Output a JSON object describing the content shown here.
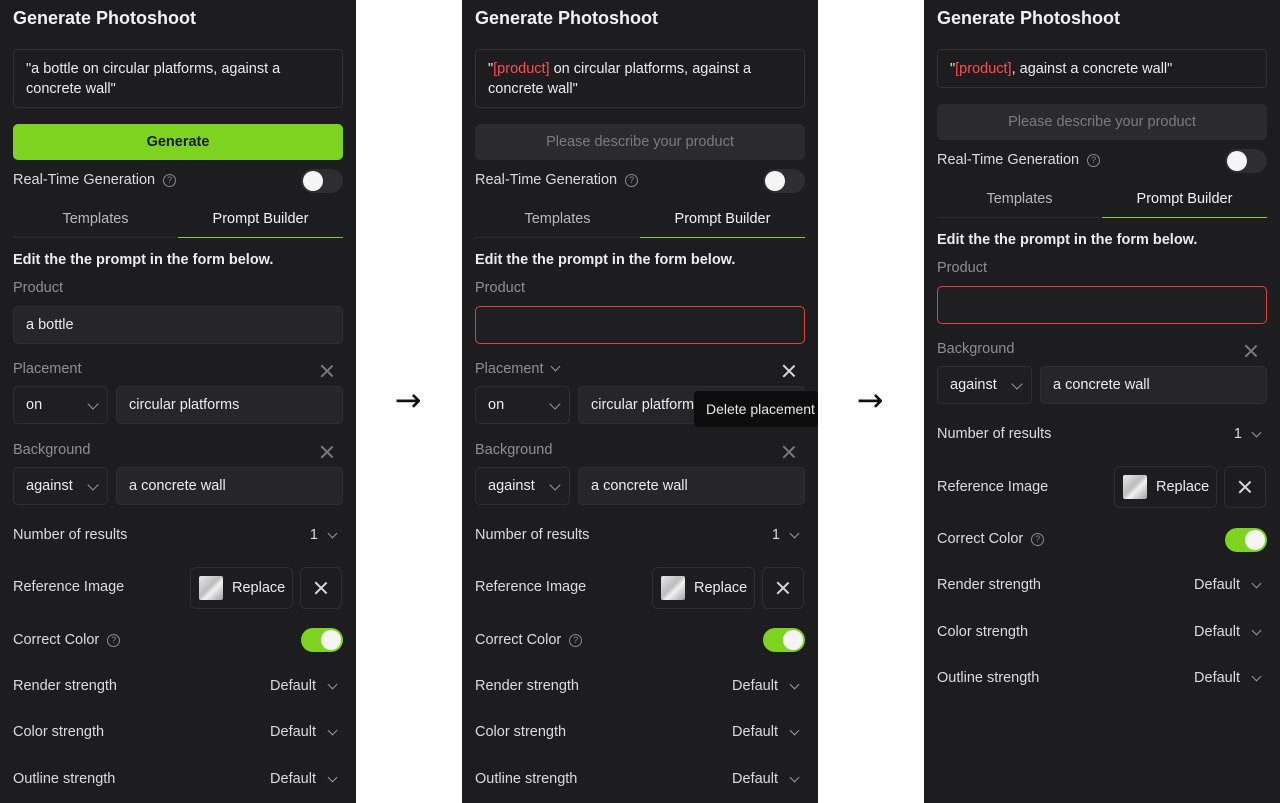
{
  "arrow_glyph": "→",
  "panel1": {
    "title": "Generate Photoshoot",
    "prompt_a": "\"a bottle on circular platforms, against a",
    "prompt_b": "concrete wall\"",
    "generate_label": "Generate",
    "realtime_label": "Real-Time Generation",
    "tab_templates": "Templates",
    "tab_builder": "Prompt Builder",
    "hint": "Edit the the prompt in the form below.",
    "product_label": "Product",
    "product_value": "a bottle",
    "placement_label": "Placement",
    "placement_prep": "on",
    "placement_value": "circular platforms",
    "background_label": "Background",
    "background_prep": "against",
    "background_value": "a concrete wall",
    "results_label": "Number of results",
    "results_value": "1",
    "reference_label": "Reference Image",
    "replace_label": "Replace",
    "correct_color_label": "Correct Color",
    "render_label": "Render strength",
    "render_value": "Default",
    "color_label": "Color strength",
    "color_value": "Default",
    "outline_label": "Outline strength",
    "outline_value": "Default"
  },
  "panel2": {
    "title": "Generate Photoshoot",
    "prompt_quote_open": "\"",
    "prompt_token": "[product]",
    "prompt_rest_a": " on circular platforms, against a",
    "prompt_b": "concrete wall\"",
    "generate_placeholder": "Please describe your product",
    "realtime_label": "Real-Time Generation",
    "tab_templates": "Templates",
    "tab_builder": "Prompt Builder",
    "hint": "Edit the the prompt in the form below.",
    "product_label": "Product",
    "product_value": "",
    "placement_label": "Placement",
    "placement_prep": "on",
    "placement_value": "circular platforms",
    "tooltip": "Delete placement",
    "background_label": "Background",
    "background_prep": "against",
    "background_value": "a concrete wall",
    "results_label": "Number of results",
    "results_value": "1",
    "reference_label": "Reference Image",
    "replace_label": "Replace",
    "correct_color_label": "Correct Color",
    "render_label": "Render strength",
    "render_value": "Default",
    "color_label": "Color strength",
    "color_value": "Default",
    "outline_label": "Outline strength",
    "outline_value": "Default"
  },
  "panel3": {
    "title": "Generate Photoshoot",
    "prompt_quote_open": "\"",
    "prompt_token": "[product]",
    "prompt_rest": ", against a concrete wall\"",
    "generate_placeholder": "Please describe your product",
    "realtime_label": "Real-Time Generation",
    "tab_templates": "Templates",
    "tab_builder": "Prompt Builder",
    "hint": "Edit the the prompt in the form below.",
    "product_label": "Product",
    "product_value": "",
    "background_label": "Background",
    "background_prep": "against",
    "background_value": "a concrete wall",
    "results_label": "Number of results",
    "results_value": "1",
    "reference_label": "Reference Image",
    "replace_label": "Replace",
    "correct_color_label": "Correct Color",
    "render_label": "Render strength",
    "render_value": "Default",
    "color_label": "Color strength",
    "color_value": "Default",
    "outline_label": "Outline strength",
    "outline_value": "Default"
  },
  "colors": {
    "accent": "#7ed321",
    "error": "#e0403a",
    "panel_bg": "#1d1d1f"
  }
}
